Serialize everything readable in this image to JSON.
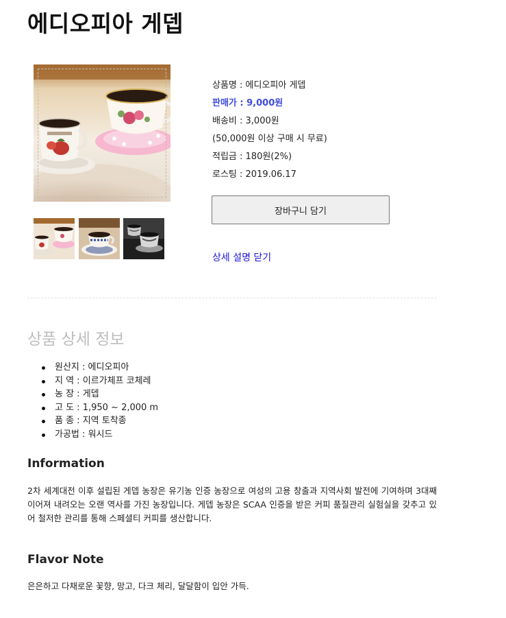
{
  "product": {
    "title": "에디오피아 게뎁",
    "name_row": "상품명 : 에디오피아 게뎁",
    "price_row": "판매가 : 9,000원",
    "shipping_row": "배송비 : 3,000원",
    "shipping_note": "(50,000원 이상 구매 시 무료)",
    "points_row": "적립금 : 180원(2%)",
    "roasting_row": "로스팅 : 2019.06.17",
    "cart_button": "장바구니 담기",
    "close_link": "상세 설명 닫기"
  },
  "images": {
    "main_alt": "coffee cups main image",
    "thumbnails": [
      "thumbnail-1",
      "thumbnail-2",
      "thumbnail-3"
    ]
  },
  "detail": {
    "section_title": "상품 상세 정보",
    "specs": [
      "원산지 : 에디오피아",
      "지 역 : 이르가체프 코체레",
      "농 장 : 게뎁",
      "고 도 : 1,950 ~ 2,000 m",
      "품 종 : 지역 토착종",
      "가공법 : 워시드"
    ],
    "information_title": "Information",
    "information_text": "2차 세계대전 이후 설립된 게뎁 농장은 유기농 인증 농장으로 여성의 고용 창출과 지역사회 발전에 기여하며 3대째 이어져 내려오는 오랜 역사를 가진 농장입니다. 게뎁 농장은 SCAA 인증을 받은 커피 품질관리 실험실을 갖추고 있어 철저한 관리를 통해 스페셜티 커피를 생산합니다.",
    "flavor_title": "Flavor Note",
    "flavor_text": "은은하고 다채로운 꽃향, 망고, 다크 체리, 달달함이 입안 가득."
  },
  "colors": {
    "price": "#3f4cdb",
    "link": "#1a16d6",
    "section_title": "#bdbdbd"
  }
}
